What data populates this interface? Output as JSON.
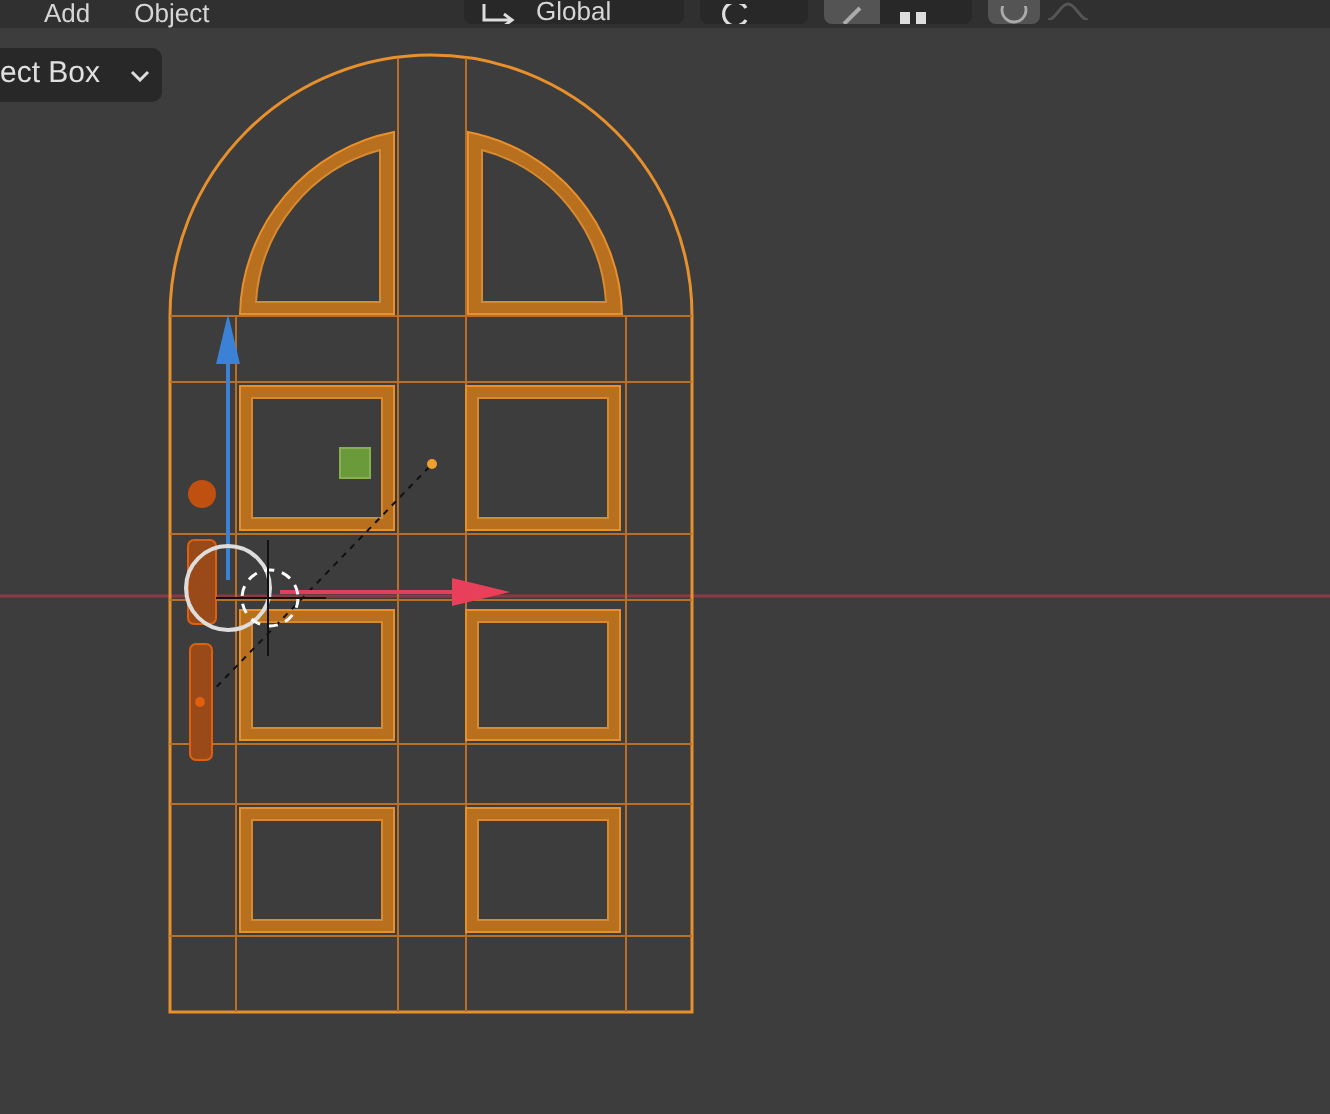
{
  "header": {
    "menus": [
      "Add",
      "Object"
    ],
    "orientation": {
      "value": "Global"
    },
    "snap": {
      "on": false
    },
    "proportional_editing": {
      "on": false
    }
  },
  "tool_settings": {
    "select_mode": "ect Box"
  }
}
